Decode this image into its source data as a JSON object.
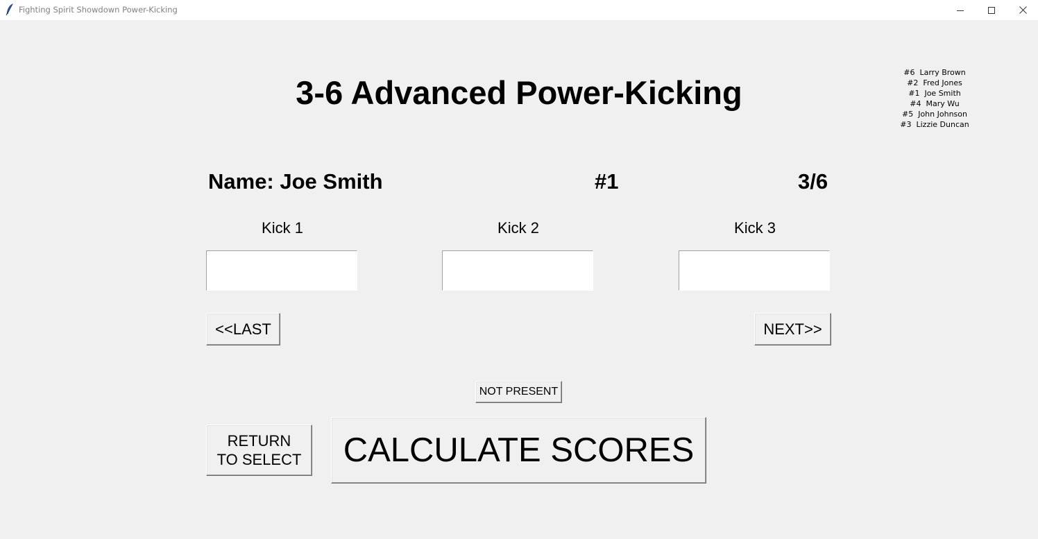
{
  "window": {
    "title": "Fighting Spirit Showdown Power-Kicking",
    "app_icon": "feather-icon",
    "controls": {
      "minimize": "minimize-icon",
      "maximize": "maximize-icon",
      "close": "close-icon"
    }
  },
  "heading": "3-6 Advanced Power-Kicking",
  "roster": [
    "#6  Larry Brown",
    "#2  Fred Jones",
    "#1  Joe Smith",
    "#4  Mary Wu",
    "#5  John Johnson",
    "#3  Lizzie Duncan"
  ],
  "competitor": {
    "name_label": "Name: Joe Smith",
    "number": "#1",
    "position": "3/6"
  },
  "kicks": [
    {
      "label": "Kick 1",
      "value": ""
    },
    {
      "label": "Kick 2",
      "value": ""
    },
    {
      "label": "Kick 3",
      "value": ""
    }
  ],
  "buttons": {
    "last": "<<LAST",
    "next": "NEXT>>",
    "not_present": "NOT PRESENT",
    "return_line1": "RETURN",
    "return_line2": "TO SELECT",
    "calculate": "CALCULATE SCORES"
  }
}
